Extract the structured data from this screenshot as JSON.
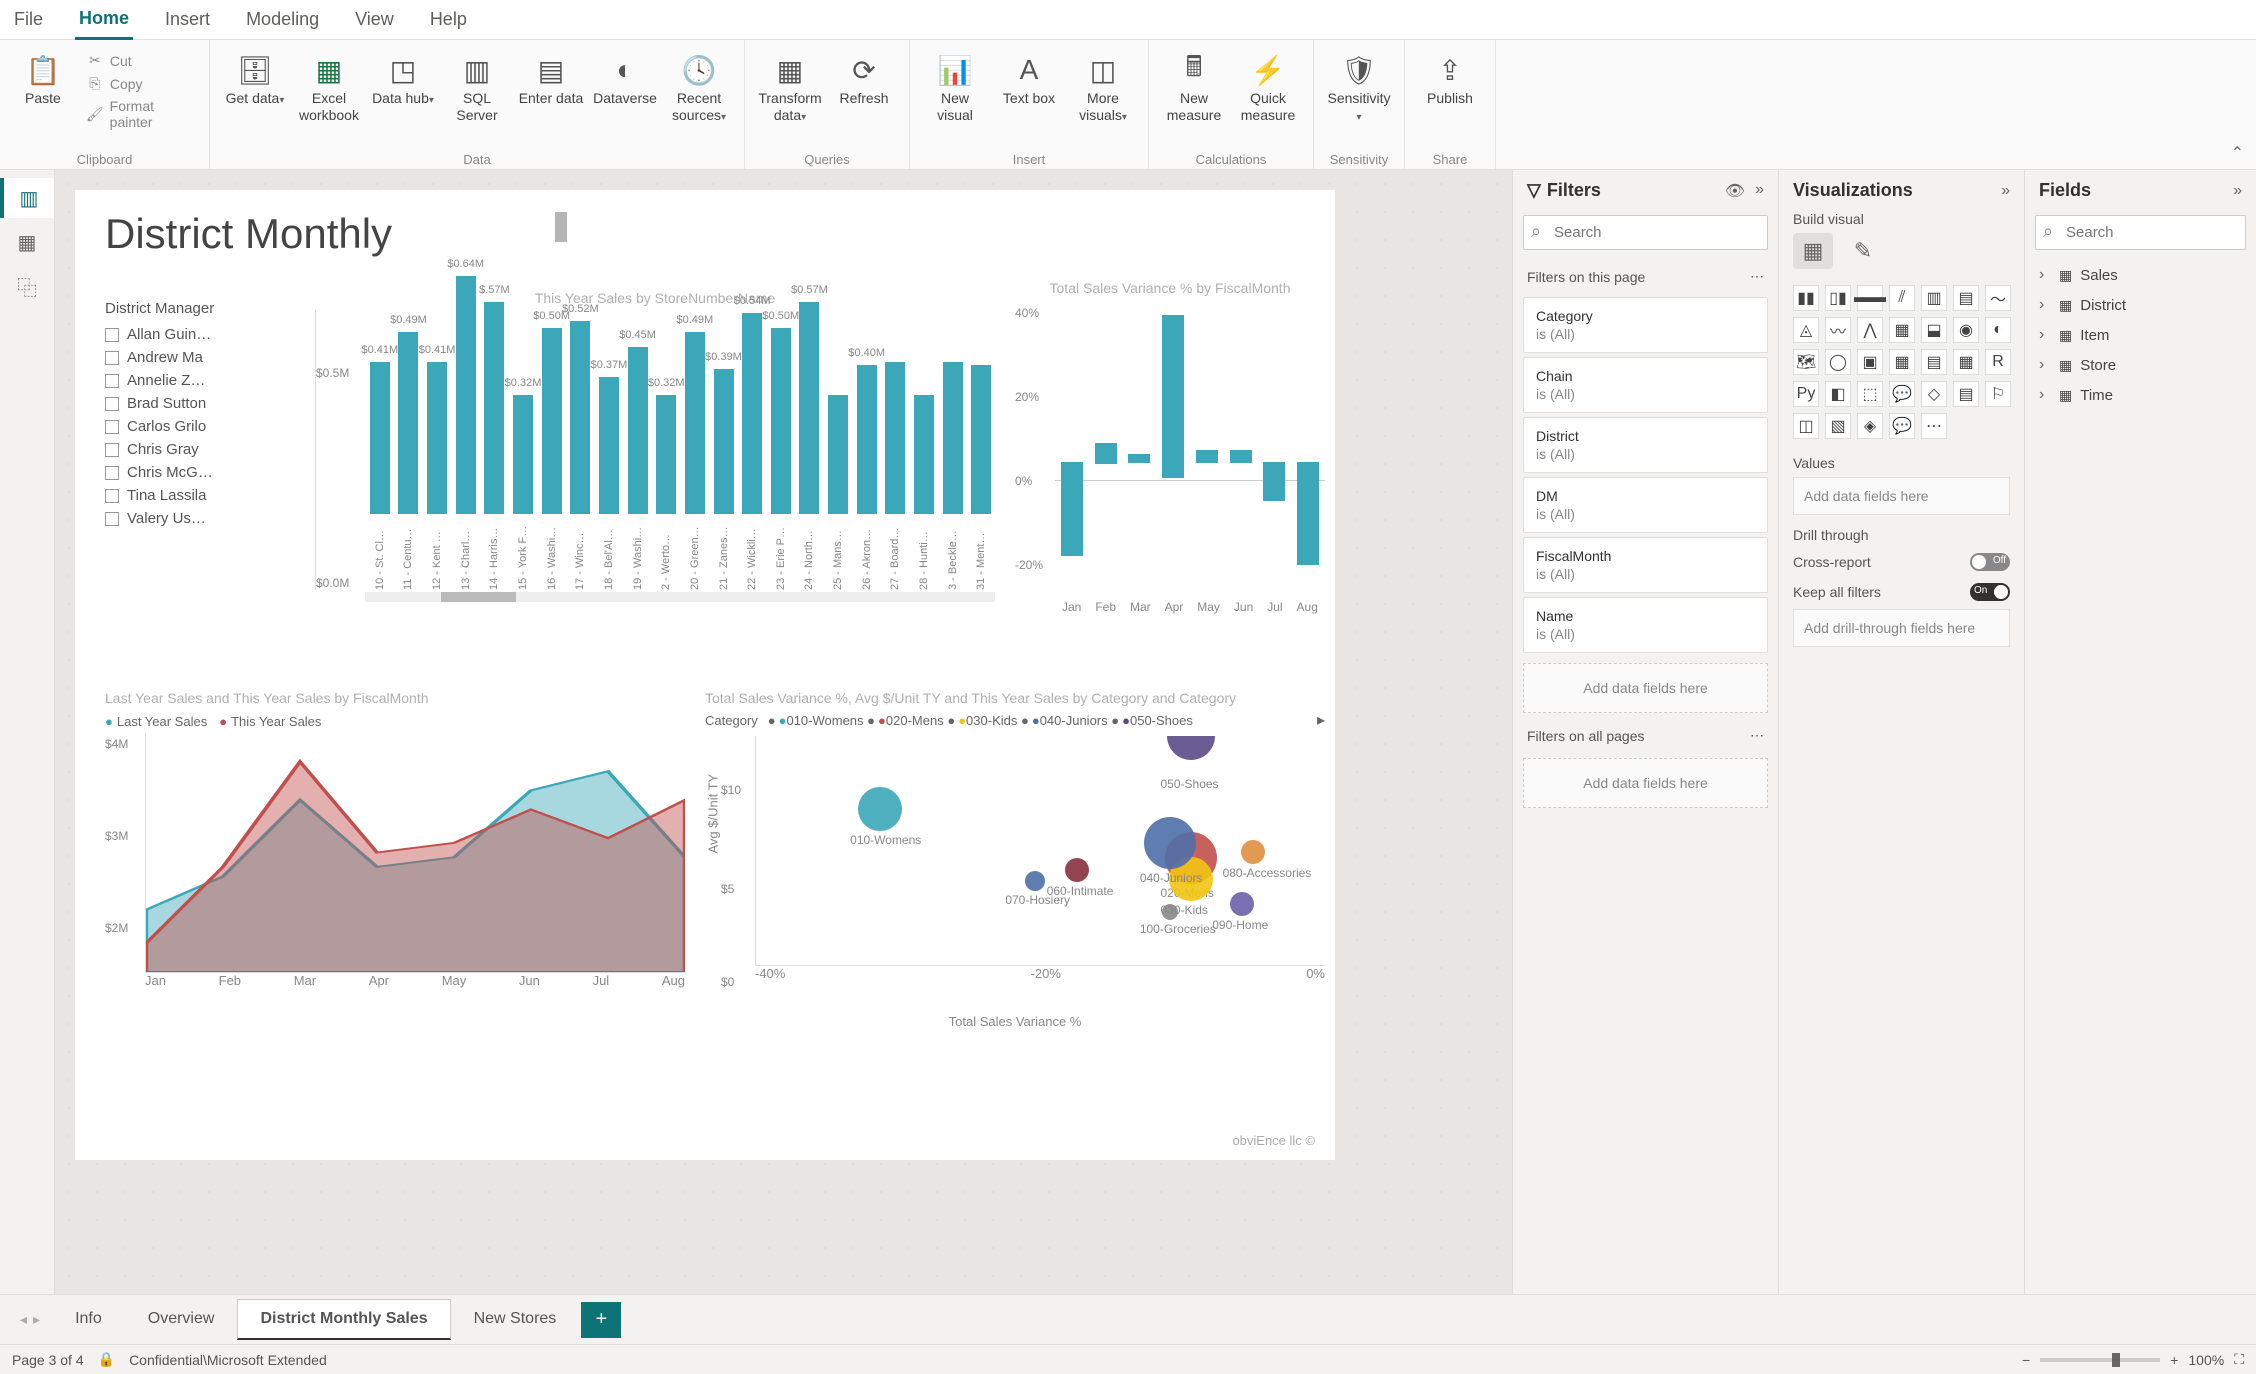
{
  "menubar": {
    "items": [
      "File",
      "Home",
      "Insert",
      "Modeling",
      "View",
      "Help"
    ],
    "active": "Home"
  },
  "ribbon": {
    "clipboard": {
      "label": "Clipboard",
      "paste": "Paste",
      "cut": "Cut",
      "copy": "Copy",
      "format_painter": "Format painter"
    },
    "data": {
      "label": "Data",
      "get_data": "Get data",
      "excel": "Excel workbook",
      "data_hub": "Data hub",
      "sql": "SQL Server",
      "enter": "Enter data",
      "dataverse": "Dataverse",
      "recent": "Recent sources"
    },
    "queries": {
      "label": "Queries",
      "transform": "Transform data",
      "refresh": "Refresh"
    },
    "insert": {
      "label": "Insert",
      "new_visual": "New visual",
      "text_box": "Text box",
      "more": "More visuals"
    },
    "calculations": {
      "label": "Calculations",
      "new_measure": "New measure",
      "quick": "Quick measure"
    },
    "sensitivity": {
      "label": "Sensitivity",
      "btn": "Sensitivity"
    },
    "share": {
      "label": "Share",
      "publish": "Publish"
    }
  },
  "report": {
    "title": "District Monthly",
    "slicer": {
      "title": "District Manager",
      "items": [
        "Allan Guin…",
        "Andrew Ma",
        "Annelie Z…",
        "Brad Sutton",
        "Carlos Grilo",
        "Chris Gray",
        "Chris McG…",
        "Tina Lassila",
        "Valery Us…"
      ]
    },
    "copyright": "obviEnce llc ©"
  },
  "chart_data": [
    {
      "id": "bar",
      "type": "bar",
      "title": "This Year Sales by StoreNumberName",
      "ylim": [
        0,
        700000
      ],
      "yticks": [
        "$0.5M",
        "$0.0M"
      ],
      "categories": [
        "10 - St. Cl…",
        "11 - Centu…",
        "12 - Kent …",
        "13 - Charl…",
        "14 - Harris…",
        "15 - York F…",
        "16 - Washi…",
        "17 - Winc…",
        "18 - Bel'Al…",
        "19 - Washi…",
        "2 - Werto…",
        "20 - Green…",
        "21 - Zanes…",
        "22 - Wickli…",
        "23 - Erie P…",
        "24 - North…",
        "25 - Mans…",
        "26 - Akron…",
        "27 - Board…",
        "28 - Hunti…",
        "3 - Beckle…",
        "31 - Ment…"
      ],
      "values": [
        410000,
        490000,
        410000,
        640000,
        570000,
        320000,
        500000,
        520000,
        370000,
        450000,
        320000,
        490000,
        390000,
        540000,
        500000,
        570000,
        320000,
        400000,
        410000,
        320000,
        410000,
        400000
      ],
      "labels": [
        "$0.41M",
        "$0.49M",
        "$0.41M",
        "$0.64M",
        "$.57M",
        "$0.32M",
        "$0.50M",
        "$0.52M",
        "$0.37M",
        "$0.45M",
        "$0.32M",
        "$0.49M",
        "$0.39M",
        "$0.54M",
        "$0.50M",
        "$0.57M",
        "",
        "$0.40M",
        "",
        "",
        "",
        ""
      ]
    },
    {
      "id": "variance",
      "type": "bar",
      "title": "Total Sales Variance % by FiscalMonth",
      "categories": [
        "Jan",
        "Feb",
        "Mar",
        "Apr",
        "May",
        "Jun",
        "Jul",
        "Aug"
      ],
      "values": [
        -22,
        5,
        2,
        38,
        3,
        3,
        -9,
        -24
      ],
      "ylim": [
        -30,
        40
      ],
      "yticks": [
        "40%",
        "20%",
        "0%",
        "-20%"
      ]
    },
    {
      "id": "area",
      "type": "area",
      "title": "Last Year Sales and This Year Sales by FiscalMonth",
      "x": [
        "Jan",
        "Feb",
        "Mar",
        "Apr",
        "May",
        "Jun",
        "Jul",
        "Aug"
      ],
      "series": [
        {
          "name": "Last Year Sales",
          "color": "#3ba7b8",
          "values": [
            2.15,
            2.5,
            3.3,
            2.6,
            2.7,
            3.4,
            3.6,
            2.7
          ]
        },
        {
          "name": "This Year Sales",
          "color": "#c0504d",
          "values": [
            1.8,
            2.6,
            3.7,
            2.75,
            2.85,
            3.2,
            2.9,
            3.3
          ]
        }
      ],
      "ylim": [
        1.5,
        4.0
      ],
      "yticks": [
        "$4M",
        "$3M",
        "$2M"
      ]
    },
    {
      "id": "scatter",
      "type": "scatter",
      "title": "Total Sales Variance %, Avg $/Unit TY and This Year Sales by Category and Category",
      "xlabel": "Total Sales Variance %",
      "ylabel": "Avg $/Unit TY",
      "xlim": [
        -45,
        10
      ],
      "ylim": [
        0,
        12
      ],
      "xticks": [
        "-40%",
        "-20%",
        "0%"
      ],
      "yticks": [
        "$10",
        "$5",
        "$0"
      ],
      "legend_label": "Category",
      "points": [
        {
          "name": "010-Womens",
          "x": -33,
          "y": 8.2,
          "r": 22,
          "color": "#3ba7b8"
        },
        {
          "name": "020-Mens",
          "x": -3,
          "y": 5.6,
          "r": 26,
          "color": "#c0504d"
        },
        {
          "name": "030-Kids",
          "x": -3,
          "y": 4.5,
          "r": 22,
          "color": "#f2c511"
        },
        {
          "name": "040-Juniors",
          "x": -5,
          "y": 6.4,
          "r": 26,
          "color": "#4f6fa8"
        },
        {
          "name": "050-Shoes",
          "x": -3,
          "y": 11.2,
          "r": 24,
          "color": "#5b4a87"
        },
        {
          "name": "060-Intimate",
          "x": -14,
          "y": 5.0,
          "r": 12,
          "color": "#882f3e"
        },
        {
          "name": "070-Hosiery",
          "x": -18,
          "y": 4.4,
          "r": 10,
          "color": "#4f6fa8"
        },
        {
          "name": "080-Accessories",
          "x": 3,
          "y": 5.9,
          "r": 12,
          "color": "#dd8f3f"
        },
        {
          "name": "090-Home",
          "x": 2,
          "y": 3.2,
          "r": 12,
          "color": "#6b5fa8"
        },
        {
          "name": "100-Groceries",
          "x": -5,
          "y": 2.8,
          "r": 8,
          "color": "#888"
        }
      ]
    }
  ],
  "filters": {
    "title": "Filters",
    "search_placeholder": "Search",
    "page_label": "Filters on this page",
    "page": [
      {
        "name": "Category",
        "value": "is (All)"
      },
      {
        "name": "Chain",
        "value": "is (All)"
      },
      {
        "name": "District",
        "value": "is (All)"
      },
      {
        "name": "DM",
        "value": "is (All)"
      },
      {
        "name": "FiscalMonth",
        "value": "is (All)"
      },
      {
        "name": "Name",
        "value": "is (All)"
      }
    ],
    "page_drop": "Add data fields here",
    "all_label": "Filters on all pages",
    "all_drop": "Add data fields here"
  },
  "viz_pane": {
    "title": "Visualizations",
    "sub": "Build visual",
    "values_label": "Values",
    "values_well": "Add data fields here",
    "drill_label": "Drill through",
    "cross": "Cross-report",
    "cross_state": "Off",
    "keep": "Keep all filters",
    "keep_state": "On",
    "drill_well": "Add drill-through fields here"
  },
  "fields": {
    "title": "Fields",
    "search_placeholder": "Search",
    "tables": [
      "Sales",
      "District",
      "Item",
      "Store",
      "Time"
    ]
  },
  "sheets": {
    "tabs": [
      "Info",
      "Overview",
      "District Monthly Sales",
      "New Stores"
    ],
    "active": "District Monthly Sales"
  },
  "status": {
    "page": "Page 3 of 4",
    "classification": "Confidential\\Microsoft Extended",
    "zoom": "100%"
  }
}
